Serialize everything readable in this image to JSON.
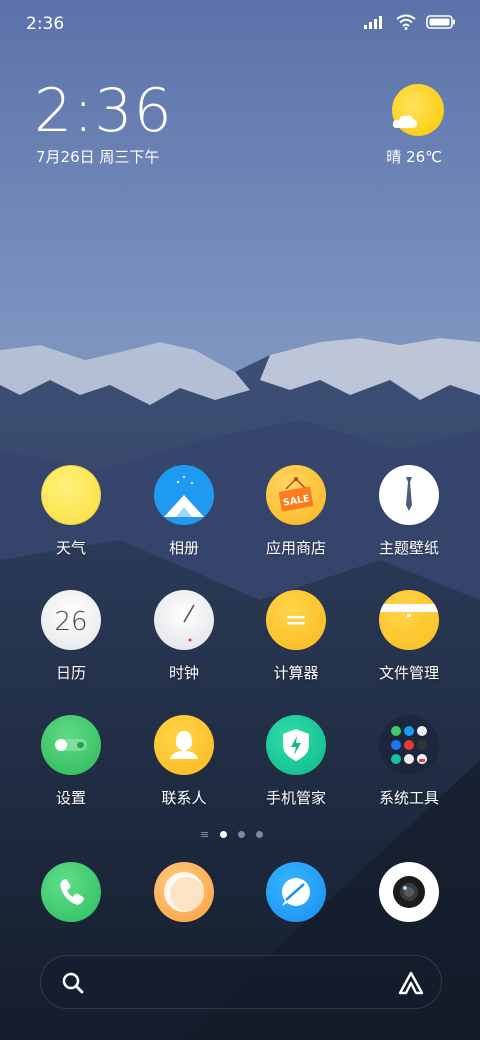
{
  "status_bar": {
    "time": "2:36",
    "icons": [
      "signal-icon",
      "wifi-icon",
      "battery-icon"
    ]
  },
  "clock_widget": {
    "time": "2:36",
    "date": "7月26日 周三下午"
  },
  "weather_widget": {
    "text": "晴 26℃",
    "icon": "sunny-cloud-icon"
  },
  "apps": [
    {
      "label": "天气",
      "icon": "weather-icon"
    },
    {
      "label": "相册",
      "icon": "gallery-icon"
    },
    {
      "label": "应用商店",
      "icon": "app-store-icon",
      "badge": "SALE"
    },
    {
      "label": "主题壁纸",
      "icon": "themes-icon"
    },
    {
      "label": "日历",
      "icon": "calendar-icon",
      "day": "26"
    },
    {
      "label": "时钟",
      "icon": "clock-icon"
    },
    {
      "label": "计算器",
      "icon": "calculator-icon"
    },
    {
      "label": "文件管理",
      "icon": "file-manager-icon"
    },
    {
      "label": "设置",
      "icon": "settings-icon"
    },
    {
      "label": "联系人",
      "icon": "contacts-icon"
    },
    {
      "label": "手机管家",
      "icon": "security-icon"
    },
    {
      "label": "系统工具",
      "icon": "system-tools-folder-icon"
    }
  ],
  "page_indicator": {
    "pages": 3,
    "current": 1
  },
  "dock": [
    {
      "icon": "phone-icon"
    },
    {
      "icon": "messages-icon"
    },
    {
      "icon": "browser-icon"
    },
    {
      "icon": "camera-icon"
    }
  ],
  "search_bar": {
    "left_icon": "search-icon",
    "right_icon": "assistant-icon"
  },
  "colors": {
    "sun": "#F9C700",
    "gallery": "#1E9BF0",
    "settings": "#3DC46A",
    "security": "#16C39A",
    "phone": "#3DCB6A",
    "browser": "#1A9AF4"
  }
}
